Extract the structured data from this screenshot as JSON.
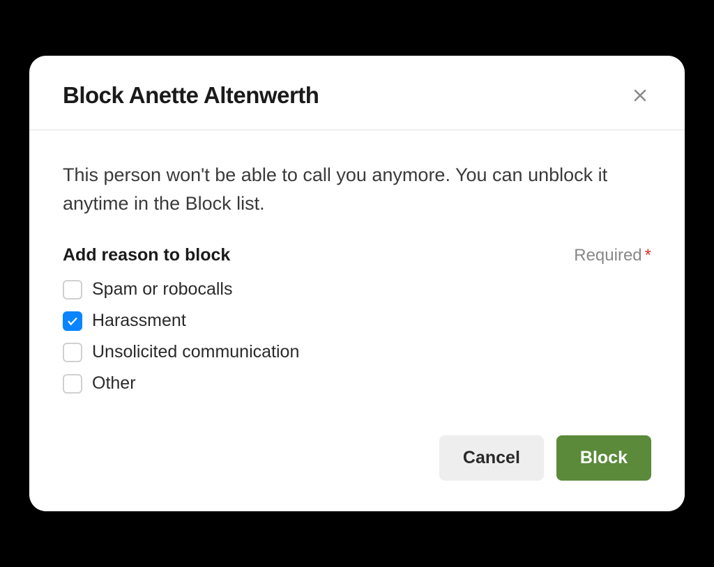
{
  "dialog": {
    "title": "Block Anette Altenwerth",
    "description": "This person won't be able to call you anymore. You can unblock it anytime in the Block list.",
    "reason": {
      "title": "Add reason to block",
      "required_label": "Required",
      "options": [
        {
          "label": "Spam or robocalls",
          "checked": false
        },
        {
          "label": "Harassment",
          "checked": true
        },
        {
          "label": "Unsolicited communication",
          "checked": false
        },
        {
          "label": "Other",
          "checked": false
        }
      ]
    },
    "buttons": {
      "cancel": "Cancel",
      "block": "Block"
    }
  }
}
